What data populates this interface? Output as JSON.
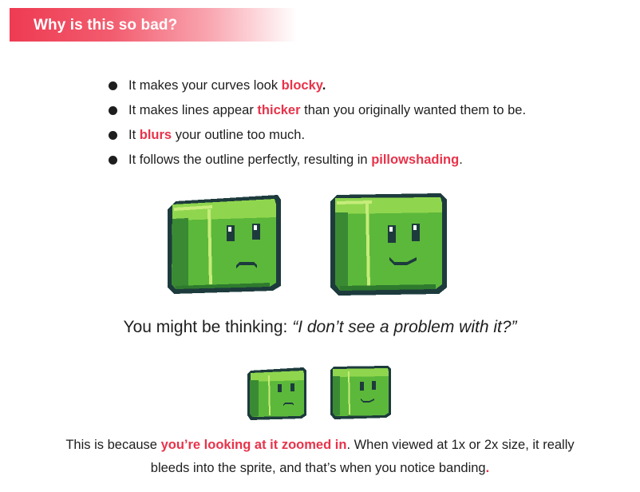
{
  "header": {
    "title": "Why is this so bad?"
  },
  "bullets": [
    {
      "before": "It makes your curves look ",
      "highlight": "blocky",
      "after": "."
    },
    {
      "before": "It makes lines appear ",
      "highlight": "thicker",
      "after": " than you originally wanted them to be."
    },
    {
      "before": "It ",
      "highlight": "blurs",
      "after": " your outline too much."
    },
    {
      "before": "It follows the outline perfectly, resulting in ",
      "highlight": "pillowshading",
      "after": "."
    }
  ],
  "question": {
    "prefix": "You might be thinking: ",
    "quote": "“I don’t see a problem with it?”"
  },
  "footer": {
    "line1_before": "This is because ",
    "line1_highlight": "you’re looking at it zoomed in",
    "line1_after": ". When viewed at 1x or 2x size, it really",
    "line2": "bleeds into the sprite, and that’s when you notice banding",
    "line2_end": "."
  },
  "colors": {
    "accent": "#e8334a",
    "text": "#1e1e1e",
    "outline": "#1d3b3d",
    "slime_light": "#8fd64e",
    "slime_mid": "#5cb83a",
    "slime_dark": "#3a8a33",
    "slime_highlight": "#c6ec7a"
  }
}
